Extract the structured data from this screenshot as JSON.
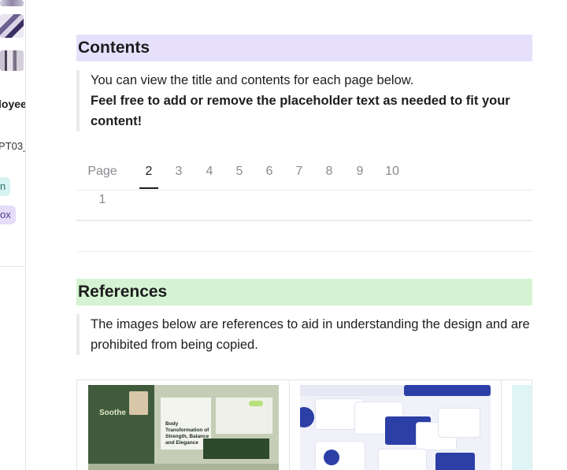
{
  "left_panel": {
    "title_fragment": "loyee",
    "code_fragment": "PT03_",
    "chip1": "n",
    "chip2": "ox"
  },
  "contents": {
    "heading": "Contents",
    "line1": "You can view the title and contents for each page below.",
    "line2": "Feel free to add or remove the placeholder text as needed to fit your content!"
  },
  "tabs": [
    {
      "label": "Page 1",
      "active": false
    },
    {
      "label": "2",
      "active": true
    },
    {
      "label": "3",
      "active": false
    },
    {
      "label": "4",
      "active": false
    },
    {
      "label": "5",
      "active": false
    },
    {
      "label": "6",
      "active": false
    },
    {
      "label": "7",
      "active": false
    },
    {
      "label": "8",
      "active": false
    },
    {
      "label": "9",
      "active": false
    },
    {
      "label": "10",
      "active": false
    }
  ],
  "references": {
    "heading": "References",
    "text": "The images below are references to aid in understanding the design and are prohibited from being copied."
  },
  "gallery": {
    "soothe_logo": "Soothe",
    "soothe_title": "Body Transformation of Strength, Balance and Elegance"
  },
  "colors": {
    "contents_heading_bg": "#e6e0fb",
    "references_heading_bg": "#d5f3d2",
    "chip_teal": "#d7f2f2",
    "chip_purple": "#e5dcfa"
  }
}
